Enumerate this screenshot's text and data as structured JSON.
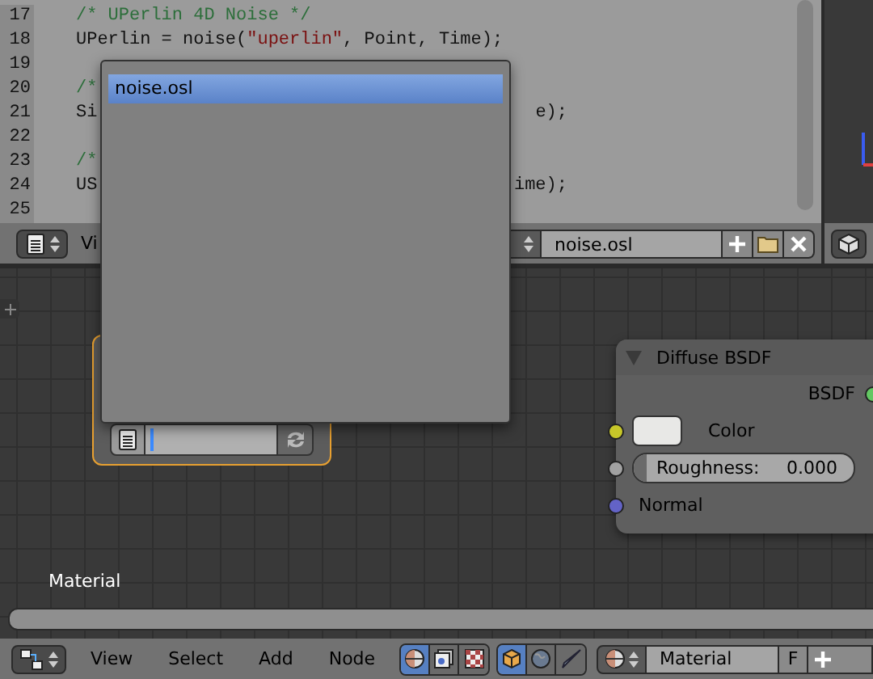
{
  "text_editor": {
    "lines": [
      {
        "number": "17",
        "left": [
          {
            "kind": "comment",
            "text": "/* UPerlin 4D Noise */"
          }
        ]
      },
      {
        "number": "18",
        "left": [
          {
            "kind": "plain",
            "text": "UPerlin = noise("
          },
          {
            "kind": "string",
            "text": "\"uperlin\""
          },
          {
            "kind": "plain",
            "text": ", Point, Time);"
          }
        ]
      },
      {
        "number": "19"
      },
      {
        "number": "20",
        "left": [
          {
            "kind": "comment",
            "text": "/*"
          }
        ]
      },
      {
        "number": "21",
        "left": [
          {
            "kind": "plain",
            "text": "Si"
          }
        ],
        "right": [
          {
            "kind": "plain",
            "text": "e);"
          }
        ]
      },
      {
        "number": "22"
      },
      {
        "number": "23",
        "left": [
          {
            "kind": "comment",
            "text": "/*"
          }
        ]
      },
      {
        "number": "24",
        "left": [
          {
            "kind": "plain",
            "text": "US"
          }
        ],
        "right": [
          {
            "kind": "plain",
            "text": "ime);"
          }
        ]
      },
      {
        "number": "25"
      }
    ],
    "header": {
      "menu": "Vi",
      "file_field": "noise.osl"
    }
  },
  "popup": {
    "items": [
      {
        "label": "noise.osl",
        "selected": true
      }
    ]
  },
  "node_editor": {
    "script_node": {
      "editing": true
    },
    "diffuse_node": {
      "title": "Diffuse BSDF",
      "expanded": true,
      "outputs": [
        {
          "label": "BSDF",
          "color": "#63c763"
        }
      ],
      "inputs": [
        {
          "kind": "color",
          "label": "Color",
          "color": "#c7c729",
          "swatch": {
            "color": "#e8e8e6"
          }
        },
        {
          "kind": "slider",
          "label": "Roughness:",
          "value": "0.000",
          "level": 0,
          "color": "#a1a1a1"
        },
        {
          "kind": "plain",
          "label": "Normal",
          "color": "#6363c7"
        }
      ]
    },
    "tree_label": "Material"
  },
  "footer": {
    "menus": [
      "View",
      "Select",
      "Add",
      "Node"
    ],
    "tree_types": [
      {
        "kind": "shader",
        "selected": true
      },
      {
        "kind": "texture",
        "selected": false
      },
      {
        "kind": "compositing",
        "selected": false
      }
    ],
    "shader_sources": [
      {
        "kind": "object",
        "selected": true
      },
      {
        "kind": "world",
        "selected": false
      },
      {
        "kind": "linestyle",
        "selected": false
      }
    ],
    "material": {
      "name": "Material",
      "fake_user": "F"
    }
  }
}
